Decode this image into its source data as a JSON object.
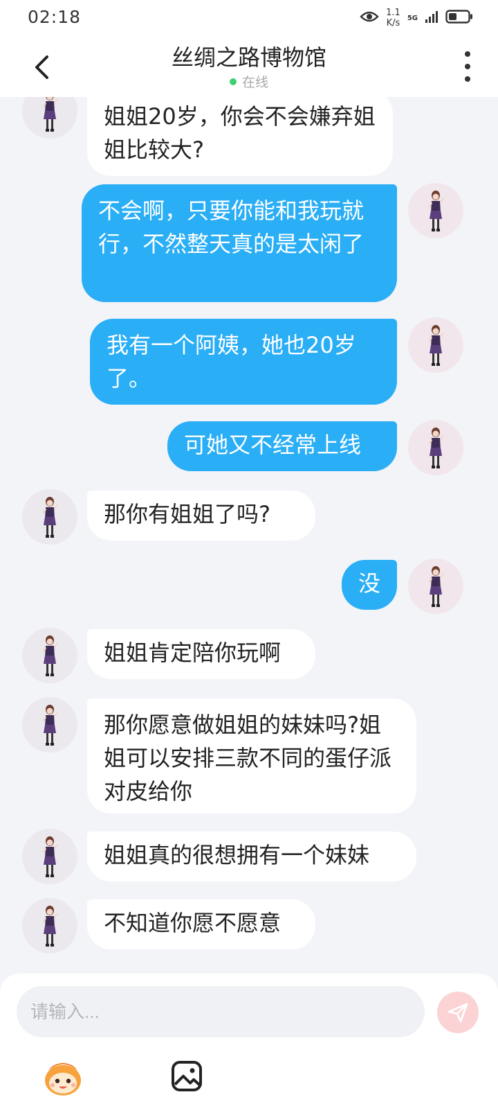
{
  "status_bar": {
    "time": "02:18",
    "net_speed_value": "1.1",
    "net_speed_unit": "K/s",
    "network_type": "5G",
    "icons": [
      "eye-icon",
      "signal-icon",
      "battery-icon"
    ]
  },
  "header": {
    "title": "丝绸之路博物馆",
    "status": "在线",
    "status_color": "#3bd16f",
    "icons": [
      "back-arrow-icon",
      "more-vertical-icon"
    ]
  },
  "messages": [
    {
      "sender": "other",
      "text": "姐姐20岁，你会不会嫌弃姐姐比较大?"
    },
    {
      "sender": "me",
      "text": "不会啊，只要你能和我玩就行，不然整天真的是太闲了"
    },
    {
      "sender": "me",
      "text": "我有一个阿姨，她也20岁了。"
    },
    {
      "sender": "me",
      "text": "可她又不经常上线"
    },
    {
      "sender": "other",
      "text": "那你有姐姐了吗?"
    },
    {
      "sender": "me",
      "text": "没"
    },
    {
      "sender": "other",
      "text": "姐姐肯定陪你玩啊"
    },
    {
      "sender": "other",
      "text": "那你愿意做姐姐的妹妹吗?姐姐可以安排三款不同的蛋仔派对皮给你"
    },
    {
      "sender": "other",
      "text": "姐姐真的很想拥有一个妹妹"
    },
    {
      "sender": "other",
      "text": "不知道你愿不愿意"
    }
  ],
  "input_bar": {
    "placeholder": "请输入...",
    "value": "",
    "icons": [
      "send-icon",
      "emoji-icon",
      "image-icon"
    ]
  },
  "colors": {
    "outgoing_bubble": "#2aaef6",
    "incoming_bubble": "#ffffff",
    "chat_background": "#f3f4f8",
    "send_button": "#fbd3d4"
  }
}
